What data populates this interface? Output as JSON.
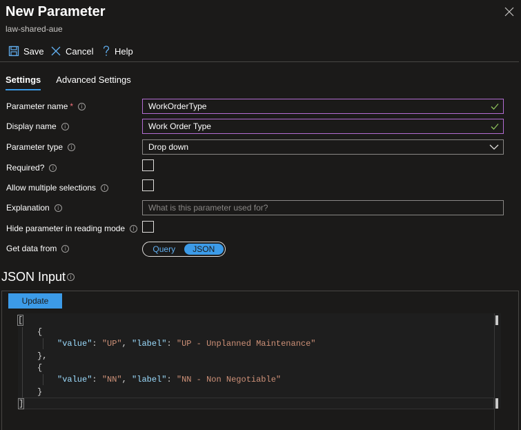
{
  "header": {
    "title": "New Parameter",
    "subtitle": "law-shared-aue"
  },
  "toolbar": {
    "save_label": "Save",
    "cancel_label": "Cancel",
    "help_label": "Help"
  },
  "tabs": [
    {
      "label": "Settings",
      "active": true
    },
    {
      "label": "Advanced Settings",
      "active": false
    }
  ],
  "form": {
    "parameter_name": {
      "label": "Parameter name",
      "required_mark": "*",
      "value": "WorkOrderType"
    },
    "display_name": {
      "label": "Display name",
      "value": "Work Order Type"
    },
    "parameter_type": {
      "label": "Parameter type",
      "value": "Drop down"
    },
    "required": {
      "label": "Required?",
      "checked": false
    },
    "allow_multiple": {
      "label": "Allow multiple selections",
      "checked": false
    },
    "explanation": {
      "label": "Explanation",
      "placeholder": "What is this parameter used for?"
    },
    "hide_parameter": {
      "label": "Hide parameter in reading mode",
      "checked": false
    },
    "get_data_from": {
      "label": "Get data from",
      "options": [
        "Query",
        "JSON"
      ],
      "selected": "JSON"
    }
  },
  "json_input": {
    "heading": "JSON Input",
    "update_label": "Update",
    "lines": {
      "l1": "[",
      "l2": "{",
      "l3_key1": "\"value\"",
      "l3_val1": "\"UP\"",
      "l3_key2": "\"label\"",
      "l3_val2": "\"UP - Unplanned Maintenance\"",
      "l4": "},",
      "l5": "{",
      "l6_key1": "\"value\"",
      "l6_val1": "\"NN\"",
      "l6_key2": "\"label\"",
      "l6_val2": "\"NN - Non Negotiable\"",
      "l7": "}",
      "l8": "]"
    }
  },
  "colors": {
    "background": "#1b1a19",
    "accent": "#3c9be8",
    "valid_border": "#b46dd4",
    "json_key": "#9cdcfe",
    "json_string": "#ce9178",
    "required": "#f1707b"
  }
}
